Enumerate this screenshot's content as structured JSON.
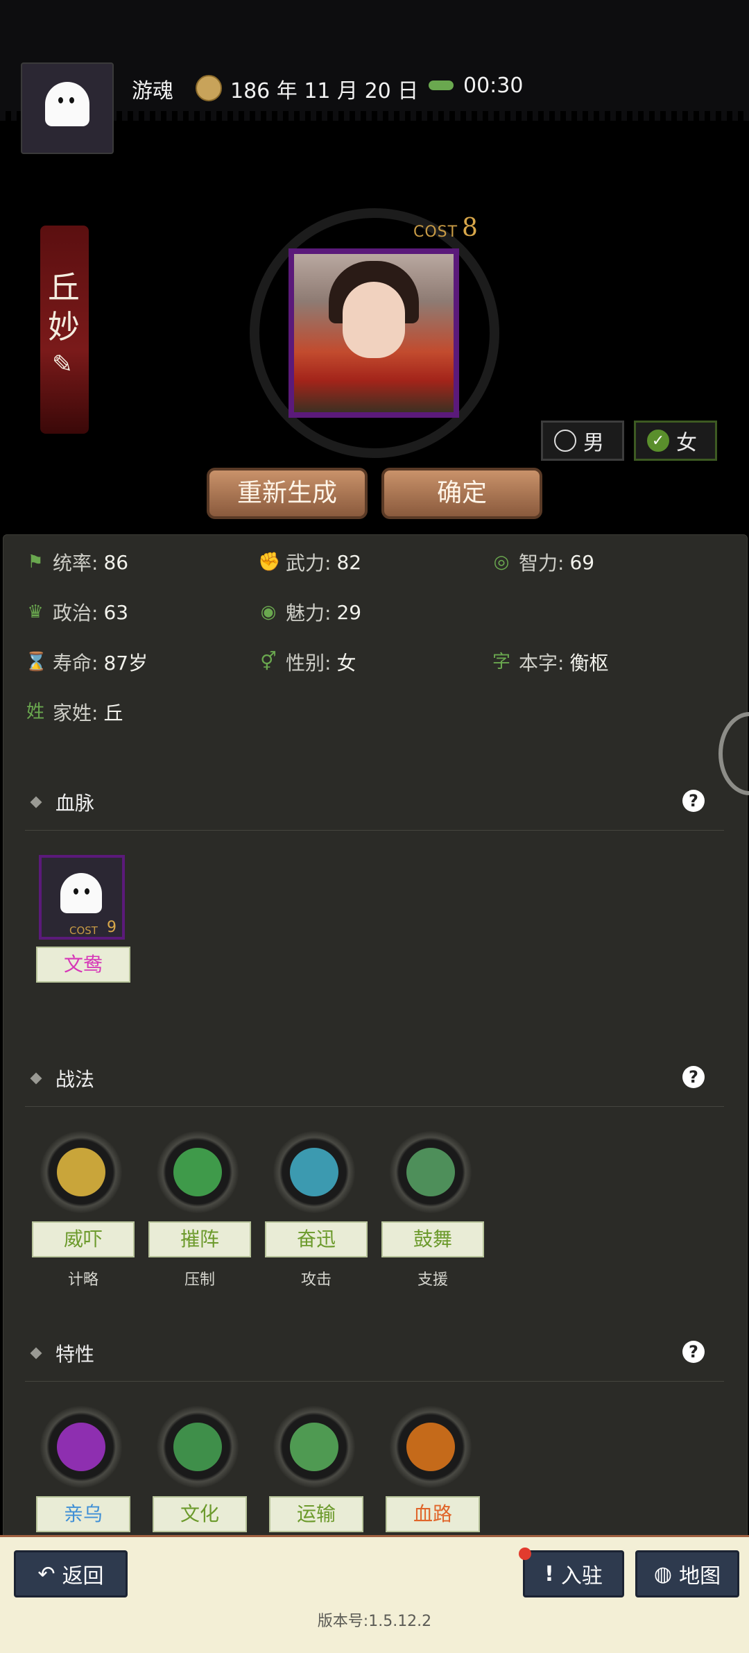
{
  "header": {
    "player_name": "游魂",
    "date": "186 年 11 月 20 日",
    "time": "00:30"
  },
  "character": {
    "name_line1": "丘",
    "name_line2": "妙",
    "cost_label": "COST",
    "cost_value": "8"
  },
  "gender": {
    "male_label": "男",
    "female_label": "女",
    "selected": "女"
  },
  "actions": {
    "regenerate_label": "重新生成",
    "confirm_label": "确定"
  },
  "stats": [
    {
      "label": "统率:",
      "value": "86"
    },
    {
      "label": "武力:",
      "value": "82"
    },
    {
      "label": "智力:",
      "value": "69"
    },
    {
      "label": "政治:",
      "value": "63"
    },
    {
      "label": "魅力:",
      "value": "29"
    },
    {
      "label": "寿命:",
      "value": "87岁"
    },
    {
      "label": "性别:",
      "value": "女"
    },
    {
      "label": "本字:",
      "value": "衡枢",
      "icon_text": "字"
    },
    {
      "label": "家姓:",
      "value": "丘",
      "icon_text": "姓"
    }
  ],
  "bloodline": {
    "title": "血脉",
    "item": {
      "cost_label": "COST",
      "cost_value": "9",
      "name": "文鸯"
    }
  },
  "tactics": {
    "title": "战法",
    "items": [
      {
        "name": "威吓",
        "type": "计略",
        "color": "#c9a53a"
      },
      {
        "name": "摧阵",
        "type": "压制",
        "color": "#3f9a4a"
      },
      {
        "name": "奋迅",
        "type": "攻击",
        "color": "#3c9ab0"
      },
      {
        "name": "鼓舞",
        "type": "支援",
        "color": "#4e8f5a"
      }
    ]
  },
  "traits": {
    "title": "特性",
    "items": [
      {
        "name": "亲乌",
        "color": "#8e2fb0",
        "text_color": "#3f8fd6"
      },
      {
        "name": "文化",
        "color": "#3f8f4a",
        "text_color": "#6c9a2c"
      },
      {
        "name": "运输",
        "color": "#4f9a52",
        "text_color": "#6c9a2c"
      },
      {
        "name": "血路",
        "color": "#c56a1a",
        "text_color": "#e0652a"
      }
    ]
  },
  "bottom_nav": {
    "back_label": "返回",
    "station_label": "入驻",
    "map_label": "地图"
  },
  "version": "版本号:1.5.12.2"
}
